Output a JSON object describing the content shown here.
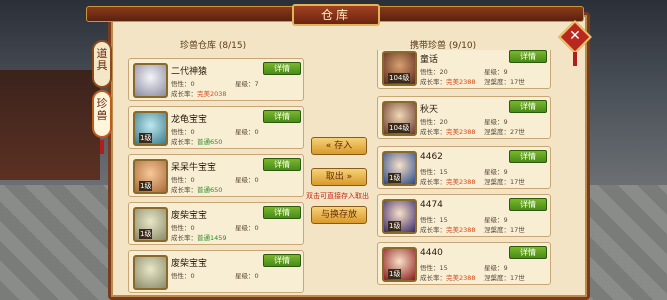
{
  "window": {
    "title": "仓库"
  },
  "side_tabs": [
    {
      "label": "道具"
    },
    {
      "label": "珍兽"
    }
  ],
  "warehouse": {
    "title": "珍兽仓库 (8/15)",
    "pets": [
      {
        "name": "二代神猿",
        "xing": "悟性：0",
        "star": "星级：7",
        "growth_label": "成长率：",
        "growth": "完美2038",
        "growth_color": "#d64a1a",
        "detail": "详情"
      },
      {
        "name": "龙龟宝宝",
        "xing": "悟性：0",
        "star": "星级：0",
        "growth_label": "成长率：",
        "growth": "普通650",
        "growth_color": "#2a8a2a",
        "detail": "详情",
        "level": "1级"
      },
      {
        "name": "呆呆牛宝宝",
        "xing": "悟性：0",
        "star": "星级：0",
        "growth_label": "成长率：",
        "growth": "普通650",
        "growth_color": "#2a8a2a",
        "detail": "详情",
        "level": "1级"
      },
      {
        "name": "废柴宝宝",
        "xing": "悟性：0",
        "star": "星级：0",
        "growth_label": "成长率：",
        "growth": "普通1459",
        "growth_color": "#2a8a2a",
        "detail": "详情",
        "level": "1级"
      },
      {
        "name": "废柴宝宝",
        "xing": "悟性：0",
        "star": "星级：0",
        "growth_label": "",
        "growth": "",
        "detail": "详情",
        "level": ""
      }
    ]
  },
  "carried": {
    "title": "携带珍兽 (9/10)",
    "pets": [
      {
        "name": "童话",
        "xing": "悟性：20",
        "star": "星级：9",
        "growth_label": "成长率：",
        "growth": "完美2388",
        "nie": "涅槃度：17世",
        "level": "104级",
        "detail": "详情"
      },
      {
        "name": "秋天",
        "xing": "悟性：20",
        "star": "星级：9",
        "growth_label": "成长率：",
        "growth": "完美2388",
        "nie": "涅槃度：27世",
        "level": "104级",
        "detail": "详情"
      },
      {
        "name": "4462",
        "xing": "悟性：15",
        "star": "星级：9",
        "growth_label": "成长率：",
        "growth": "完美2388",
        "nie": "涅槃度：17世",
        "level": "1级",
        "detail": "详情"
      },
      {
        "name": "4474",
        "xing": "悟性：15",
        "star": "星级：9",
        "growth_label": "成长率：",
        "growth": "完美2388",
        "nie": "涅槃度：17世",
        "level": "1级",
        "detail": "详情"
      },
      {
        "name": "4440",
        "xing": "悟性：15",
        "star": "星级：9",
        "growth_label": "成长率：",
        "growth": "完美2388",
        "nie": "涅槃度：17世",
        "level": "1级",
        "detail": "详情"
      }
    ]
  },
  "actions": {
    "store": "存入",
    "take": "取出",
    "swap": "与换存放",
    "hint": "双击可直接存入取出"
  },
  "close_icon": "close-x-icon"
}
